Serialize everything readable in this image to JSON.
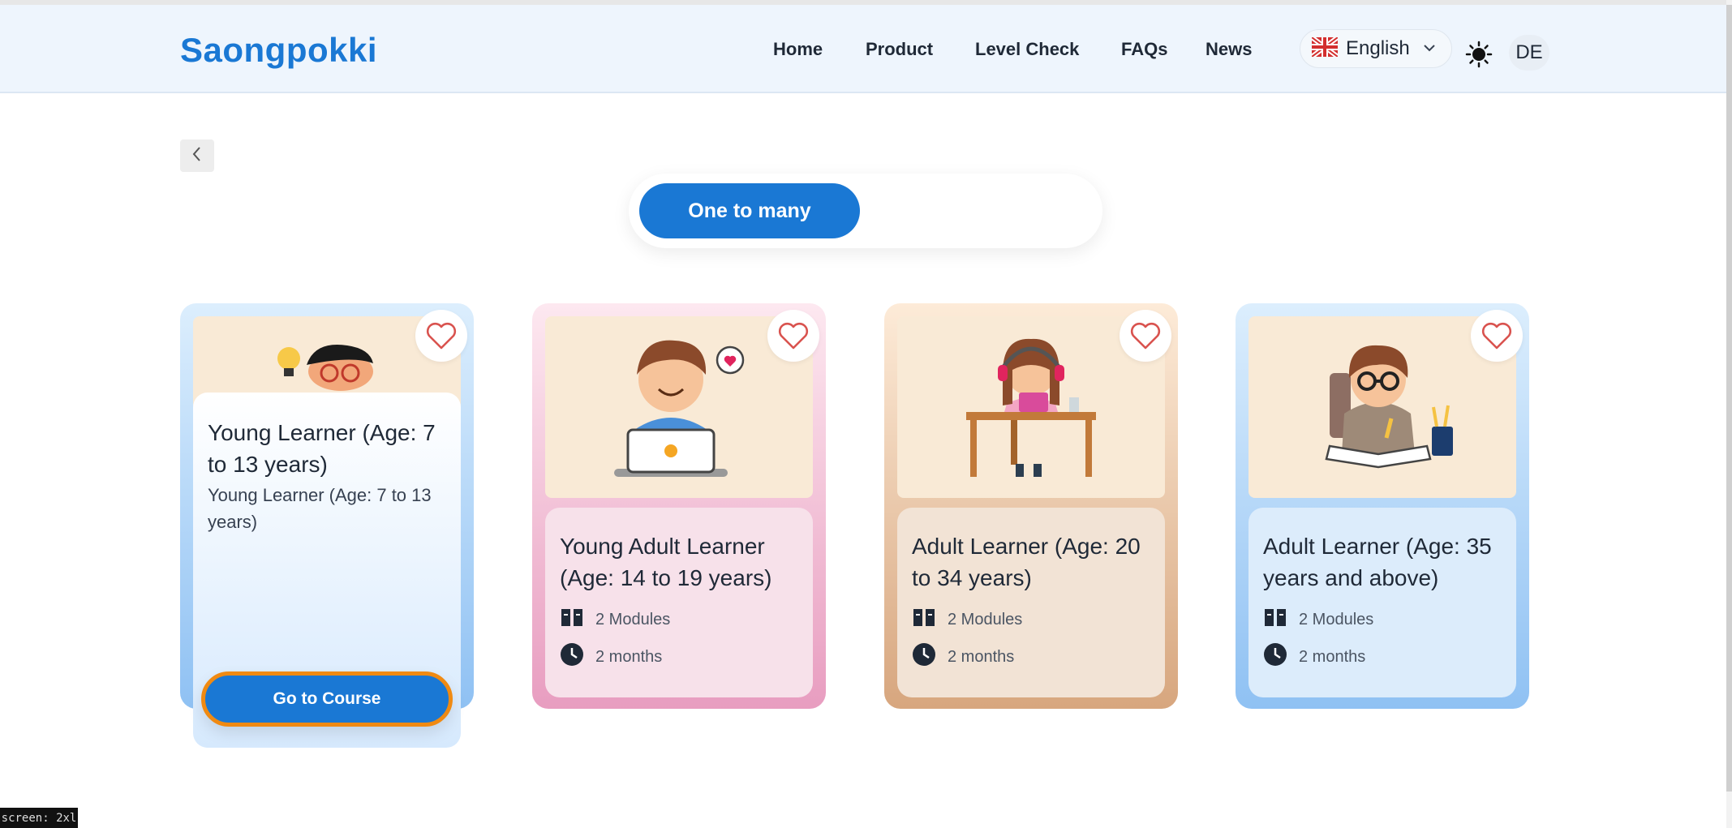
{
  "header": {
    "logo": "Saongpokki",
    "nav": [
      {
        "label": "Home"
      },
      {
        "label": "Product"
      },
      {
        "label": "Level Check"
      },
      {
        "label": "FAQs"
      },
      {
        "label": "News"
      }
    ],
    "language": {
      "label": "English",
      "flag": "uk-flag-icon"
    },
    "theme_icon": "sun-icon",
    "user_initials": "DE"
  },
  "toggle": {
    "active_label": "One to many"
  },
  "cards": [
    {
      "title": "Young Learner (Age: 7 to 13 years)",
      "subtitle": "Young Learner (Age: 7 to 13 years)",
      "button": "Go to Course"
    },
    {
      "title": "Young Adult Learner (Age: 14 to 19 years)",
      "modules": "2 Modules",
      "duration": "2 months"
    },
    {
      "title": "Adult Learner (Age: 20 to 34 years)",
      "modules": "2 Modules",
      "duration": "2 months"
    },
    {
      "title": "Adult Learner (Age: 35 years and above)",
      "modules": "2 Modules",
      "duration": "2 months"
    }
  ],
  "colors": {
    "primary": "#1a78d4",
    "focus_ring": "#f08a12",
    "heart": "#d9534f"
  },
  "status_label": "screen: 2xl"
}
